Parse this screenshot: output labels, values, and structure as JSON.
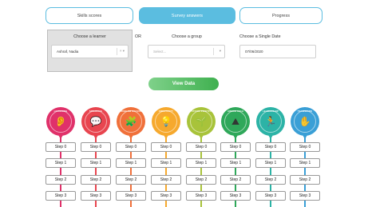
{
  "tabs": [
    {
      "label": "Skills scores",
      "active": false
    },
    {
      "label": "Survey answers",
      "active": true
    },
    {
      "label": "Progress",
      "active": false
    }
  ],
  "filters": {
    "learner_label": "Choose a learner",
    "learner_value": "Ashraf, Nadia",
    "or_label": "OR",
    "group_label": "Choose a group",
    "group_placeholder": "Select...",
    "date_label": "Choose a Single Date",
    "date_value": "07/06/2020"
  },
  "view_button": "View Data",
  "skills": [
    {
      "name": "LISTENING",
      "color": "#e0316a",
      "icon": "ear-icon",
      "glyph": "👂"
    },
    {
      "name": "SPEAKING",
      "color": "#e8454f",
      "icon": "speech-bubble-icon",
      "glyph": "💬"
    },
    {
      "name": "PROBLEM SOLVING",
      "color": "#f0703a",
      "icon": "puzzle-icon",
      "glyph": "🧩"
    },
    {
      "name": "CREATIVITY",
      "color": "#f6a92e",
      "icon": "lightbulb-icon",
      "glyph": "💡"
    },
    {
      "name": "STAYING POSITIVE",
      "color": "#a8c33a",
      "icon": "sprout-icon",
      "glyph": "🌱"
    },
    {
      "name": "AIMING HIGH",
      "color": "#2fa85a",
      "icon": "mountain-icon",
      "glyph": "⛰"
    },
    {
      "name": "LEADERSHIP",
      "color": "#2cb3a6",
      "icon": "figure-icon",
      "glyph": "🏃"
    },
    {
      "name": "TEAMWORK",
      "color": "#3a9fd6",
      "icon": "team-icon",
      "glyph": "✋"
    }
  ],
  "steps": [
    "Step 0",
    "Step 1",
    "Step 2",
    "Step 3"
  ]
}
